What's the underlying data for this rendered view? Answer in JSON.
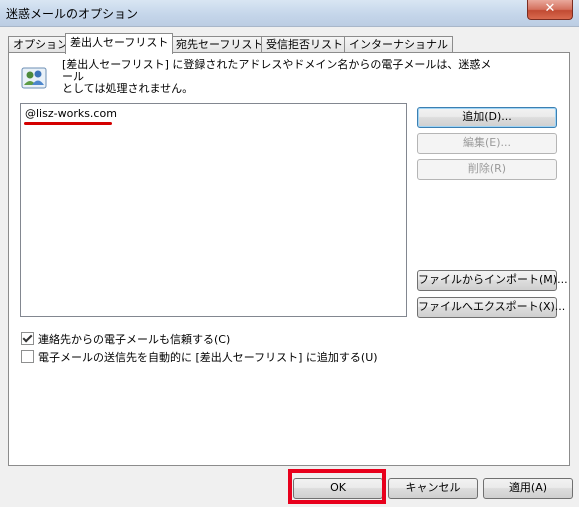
{
  "window": {
    "title": "迷惑メールのオプション",
    "close_label": "✕"
  },
  "tabs": [
    {
      "label": "オプション"
    },
    {
      "label": "差出人セーフリスト"
    },
    {
      "label": "宛先セーフリスト"
    },
    {
      "label": "受信拒否リスト"
    },
    {
      "label": "インターナショナル"
    }
  ],
  "panel": {
    "info_line1": "[差出人セーフリスト] に登録されたアドレスやドメイン名からの電子メールは、迷惑メール",
    "info_line2": "としては処理されません。",
    "list_items": [
      "@lisz-works.com"
    ],
    "buttons": {
      "add": "追加(D)...",
      "edit": "編集(E)...",
      "delete": "削除(R)",
      "import": "ファイルからインポート(M)...",
      "export": "ファイルへエクスポート(X)..."
    },
    "checkboxes": [
      {
        "label": "連絡先からの電子メールも信頼する(C)",
        "checked": true
      },
      {
        "label": "電子メールの送信先を自動的に [差出人セーフリスト] に追加する(U)",
        "checked": false
      }
    ]
  },
  "footer": {
    "ok": "OK",
    "cancel": "キャンセル",
    "apply": "適用(A)"
  },
  "colors": {
    "highlight": "#e8001c",
    "underline": "#d40000"
  }
}
